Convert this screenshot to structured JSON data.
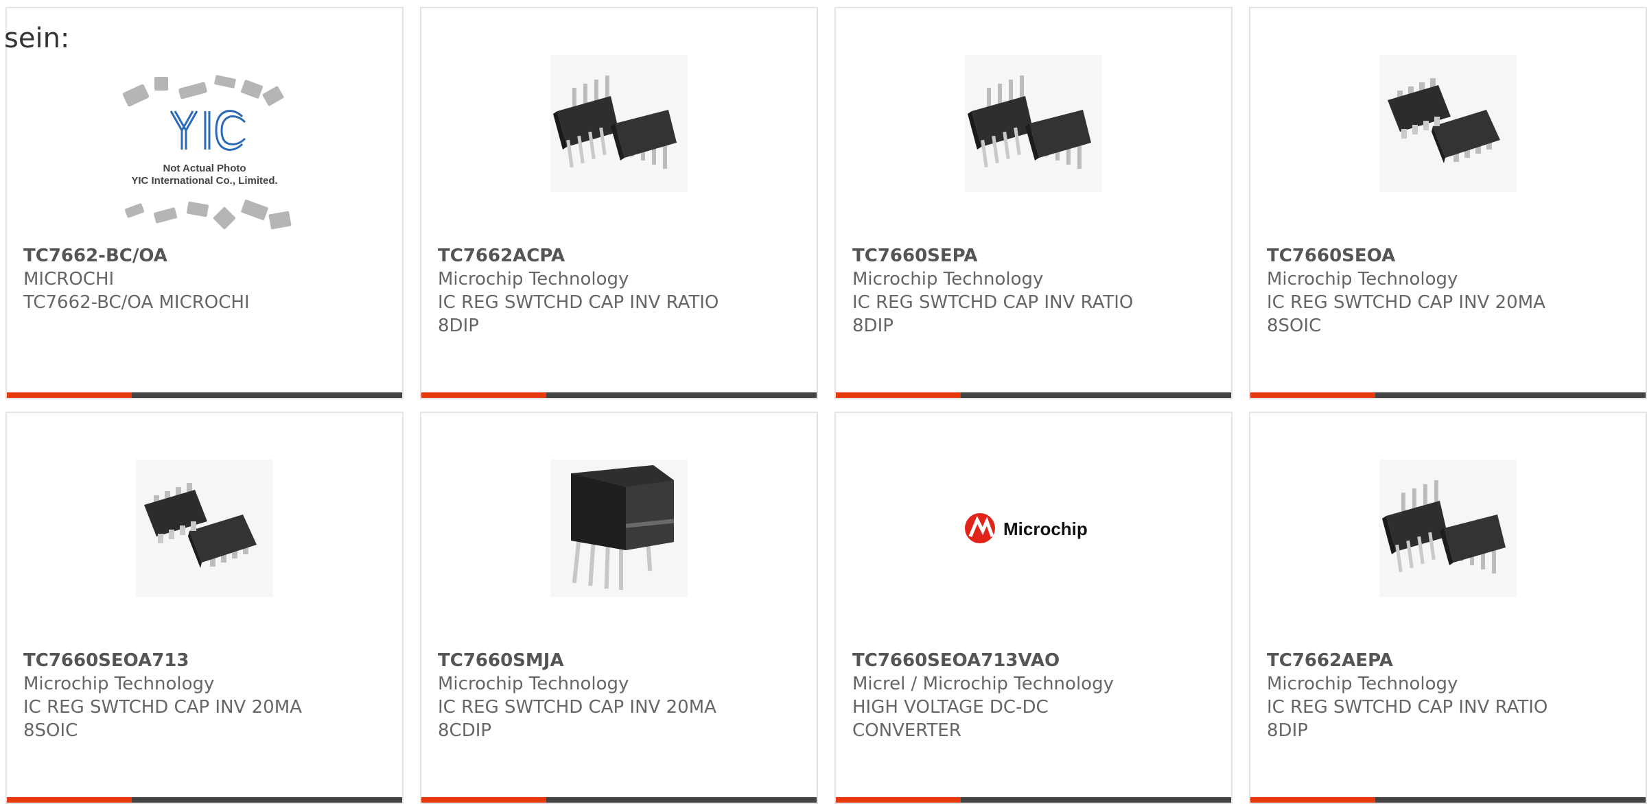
{
  "heading": "sein:",
  "colors": {
    "accent": "#e8390e",
    "bar": "#444444",
    "border": "#e3e3e3"
  },
  "products": [
    {
      "part": "TC7662-BC/OA",
      "manufacturer": "MICROCHI",
      "description": "TC7662-BC/OA MICROCHI",
      "image": "yic-placeholder-photo",
      "photo_caption": [
        "Not Actual Photo",
        "YIC International Co., Limited."
      ]
    },
    {
      "part": "TC7662ACPA",
      "manufacturer": "Microchip Technology",
      "description": "IC REG SWTCHD CAP INV RATIO 8DIP",
      "image": "dip8-chip-photo"
    },
    {
      "part": "TC7660SEPA",
      "manufacturer": "Microchip Technology",
      "description": "IC REG SWTCHD CAP INV RATIO 8DIP",
      "image": "dip8-chip-photo"
    },
    {
      "part": "TC7660SEOA",
      "manufacturer": "Microchip Technology",
      "description": "IC REG SWTCHD CAP INV 20MA 8SOIC",
      "image": "soic8-chip-photo"
    },
    {
      "part": "TC7660SEOA713",
      "manufacturer": "Microchip Technology",
      "description": "IC REG SWTCHD CAP INV 20MA 8SOIC",
      "image": "soic8-chip-photo"
    },
    {
      "part": "TC7660SMJA",
      "manufacturer": "Microchip Technology",
      "description": "IC REG SWTCHD CAP INV 20MA 8CDIP",
      "image": "cdip8-chip-photo"
    },
    {
      "part": "TC7660SEOA713VAO",
      "manufacturer": "Micrel / Microchip Technology",
      "description": "HIGH VOLTAGE DC-DC CONVERTER",
      "image": "microchip-logo",
      "logo_text": "Microchip"
    },
    {
      "part": "TC7662AEPA",
      "manufacturer": "Microchip Technology",
      "description": "IC REG SWTCHD CAP INV RATIO 8DIP",
      "image": "dip8-chip-photo"
    }
  ]
}
